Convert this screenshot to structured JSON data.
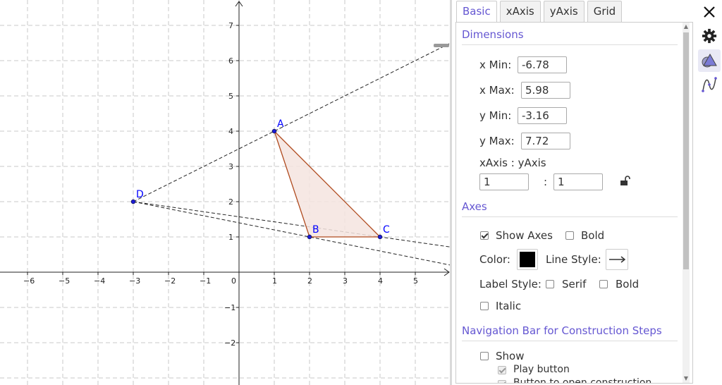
{
  "graphics": {
    "x_tick_labels": [
      "−6",
      "−5",
      "−4",
      "−3",
      "−2",
      "−1",
      "0",
      "1",
      "2",
      "3",
      "4",
      "5"
    ],
    "y_tick_labels": [
      "7",
      "6",
      "5",
      "4",
      "3",
      "2",
      "1",
      "−1",
      "−2"
    ],
    "points": [
      {
        "label": "A",
        "x": 1,
        "y": 4
      },
      {
        "label": "B",
        "x": 2,
        "y": 1
      },
      {
        "label": "C",
        "x": 4,
        "y": 1
      },
      {
        "label": "D",
        "x": -3,
        "y": 2
      }
    ],
    "colors": {
      "point": "#1c1cd4",
      "label": "#0000ff",
      "triangle_stroke": "#b04a1e",
      "triangle_fill": "#f4e4df",
      "grid": "#c8c8c8"
    }
  },
  "tabs": [
    {
      "label": "Basic",
      "active": true
    },
    {
      "label": "xAxis",
      "active": false
    },
    {
      "label": "yAxis",
      "active": false
    },
    {
      "label": "Grid",
      "active": false
    }
  ],
  "dimensions": {
    "title": "Dimensions",
    "xmin_label": "x Min:",
    "xmin_value": "-6.78",
    "xmax_label": "x Max:",
    "xmax_value": "5.98",
    "ymin_label": "y Min:",
    "ymin_value": "-3.16",
    "ymax_label": "y Max:",
    "ymax_value": "7.72",
    "ratio_label": "xAxis : yAxis",
    "ratio_x": "1",
    "ratio_sep": ":",
    "ratio_y": "1"
  },
  "axes": {
    "title": "Axes",
    "show_axes_label": "Show Axes",
    "show_axes_checked": true,
    "bold_label": "Bold",
    "bold_checked": false,
    "color_label": "Color:",
    "color_value": "#000000",
    "line_style_label": "Line Style:",
    "label_style_label": "Label Style:",
    "serif_label": "Serif",
    "label_bold_label": "Bold",
    "italic_label": "Italic"
  },
  "navigation": {
    "title": "Navigation Bar for Construction Steps",
    "show_label": "Show",
    "show_checked": false,
    "play_button_label": "Play button",
    "play_checked": true,
    "open_construction_label": "Button to open construction",
    "open_checked": true
  },
  "accent_color": "#6557d2"
}
